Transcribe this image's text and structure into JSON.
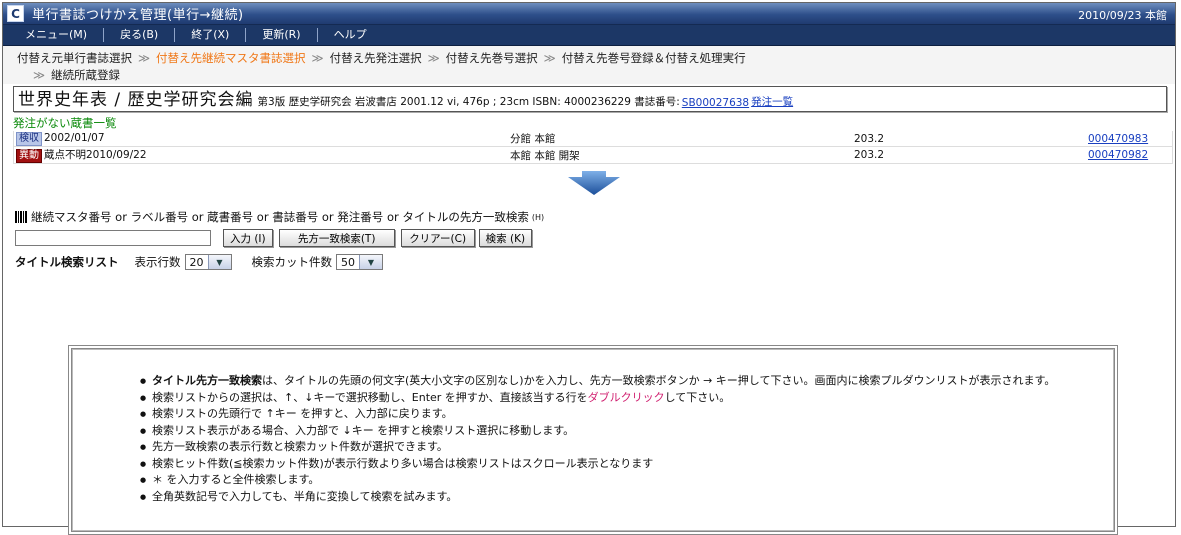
{
  "window": {
    "title": "単行書誌つけかえ管理(単行→継続)",
    "status": "2010/09/23 本館"
  },
  "menu": [
    {
      "label": "メニュー(M)"
    },
    {
      "label": "戻る(B)"
    },
    {
      "label": "終了(X)"
    },
    {
      "label": "更新(R)"
    },
    {
      "label": "ヘルプ"
    }
  ],
  "breadcrumb": {
    "items": [
      {
        "label": "付替え元単行書誌選択"
      },
      {
        "label": "付替え先継続マスタ書誌選択"
      },
      {
        "label": "付替え先発注選択"
      },
      {
        "label": "付替え先巻号選択"
      },
      {
        "label": "付替え先巻号登録＆付替え処理実行"
      }
    ],
    "line2": "継続所蔵登録",
    "separator": "≫",
    "active_color": "#f07818"
  },
  "book": {
    "title": "世界史年表 / 歴史学研究会編",
    "details": "第3版 歴史学研究会 岩波書店 2001.12 vi, 476p ; 23cm ISBN: 4000236229 書誌番号:",
    "biblio_id": "SB00027638",
    "order_link": "発注一覧"
  },
  "holdings": {
    "heading": "発注がない蔵書一覧",
    "rows": [
      {
        "badge": "検収",
        "status": "2002/01/07",
        "location": "分館 本館",
        "class": "203.2",
        "id": "000470983"
      },
      {
        "badge": "異動",
        "status": "蔵点不明2010/09/22",
        "location": "本館 本館 開架",
        "class": "203.2",
        "id": "000470982"
      }
    ]
  },
  "search": {
    "label": "継続マスタ番号 or ラベル番号 or 蔵書番号 or 書誌番号 or 発注番号 or タイトルの先方一致検索",
    "label_hotkey": "(H)",
    "input_value": "",
    "buttons": {
      "input": "入力 (I)",
      "prefix": "先方一致検索(T)",
      "clear": "クリアー(C)",
      "search": "検索 (K)"
    },
    "list_title": "タイトル検索リスト",
    "rows_label": "表示行数",
    "rows_value": "20",
    "cut_label": "検索カット件数",
    "cut_value": "50"
  },
  "help": {
    "items": [
      {
        "bold": "タイトル先方一致検索",
        "text": "は、タイトルの先頭の何文字(英大小文字の区別なし)かを入力し、先方一致検索ボタンか → キー押して下さい。画面内に検索プルダウンリストが表示されます。"
      },
      {
        "text": "検索リストからの選択は、↑、↓キーで選択移動し、Enter を押すか、直接該当する行を",
        "pink": "ダブルクリック",
        "tail": "して下さい。"
      },
      {
        "text": "検索リストの先頭行で ↑キー を押すと、入力部に戻ります。"
      },
      {
        "text": "検索リスト表示がある場合、入力部で ↓キー を押すと検索リスト選択に移動します。"
      },
      {
        "text": "先方一致検索の表示行数と検索カット件数が選択できます。"
      },
      {
        "text": "検索ヒット件数(≦検索カット件数)が表示行数より多い場合は検索リストはスクロール表示となります"
      },
      {
        "text": "＊ を入力すると全件検索します。"
      },
      {
        "text": "全角英数記号で入力しても、半角に変換して検索を試みます。"
      }
    ],
    "pink_color": "#d02070"
  }
}
